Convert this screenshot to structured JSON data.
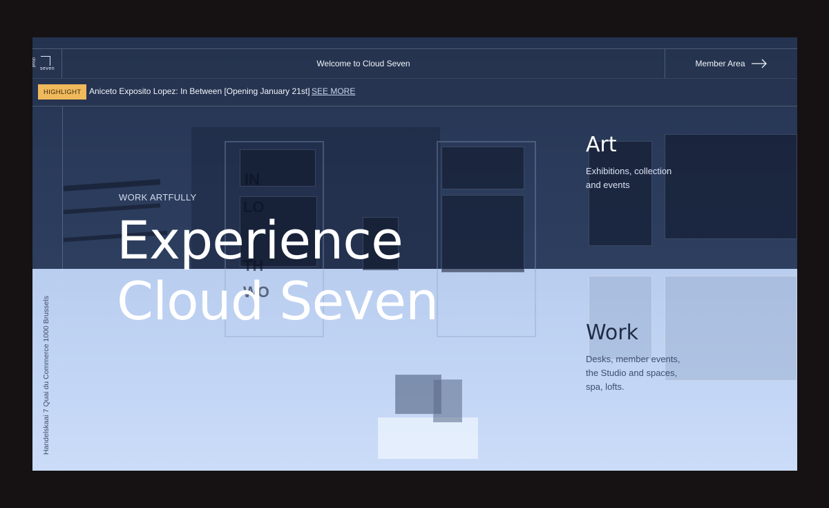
{
  "header": {
    "logo_text": "seven",
    "logo_text_vertical": "cloud",
    "welcome": "Welcome to Cloud Seven",
    "member_area": "Member Area"
  },
  "highlight": {
    "badge": "HIGHLIGHT",
    "text": "Aniceto Exposito Lopez: In Between [Opening January 21st]",
    "link": "SEE MORE"
  },
  "rail": {
    "address": "Handelskaai 7 Quai du Commerce 1000 Brussels"
  },
  "hero": {
    "kicker": "WORK ARTFULLY",
    "line1": "Experience",
    "line2": "Cloud Seven"
  },
  "sections": {
    "art": {
      "title": "Art",
      "desc": "Exhibitions, collection and events"
    },
    "work": {
      "title": "Work",
      "desc": "Desks, member events, the Studio and spaces, spa, lofts."
    }
  },
  "background_art_letters": [
    "IN",
    "LO",
    "TH",
    "WO"
  ],
  "colors": {
    "frame_bg": "#161112",
    "top_overlay": "#2a3956",
    "bottom_overlay": "#c3d6f5",
    "badge": "#f0b95b"
  }
}
